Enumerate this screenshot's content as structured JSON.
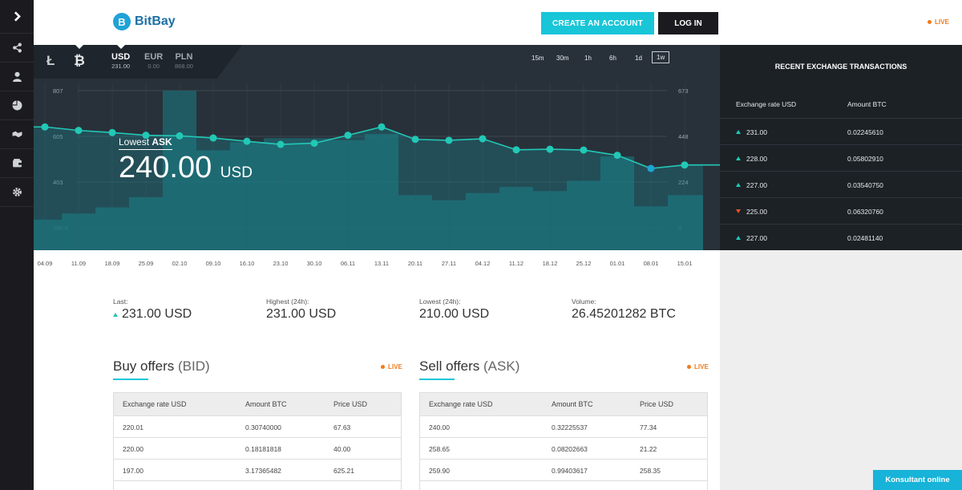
{
  "header": {
    "logo_text": "BitBay",
    "logo_badge": "B",
    "create_account": "CREATE AN ACCOUNT",
    "login": "LOG IN",
    "live": "LIVE"
  },
  "coins": {
    "litecoin": "Ł",
    "bitcoin": "₿"
  },
  "currencies": [
    {
      "name": "USD",
      "value": "231.00",
      "active": true
    },
    {
      "name": "EUR",
      "value": "0.00",
      "active": false
    },
    {
      "name": "PLN",
      "value": "868.00",
      "active": false
    }
  ],
  "timeframes": [
    {
      "label": "15m",
      "active": false
    },
    {
      "label": "30m",
      "active": false
    },
    {
      "label": "1h",
      "active": false
    },
    {
      "label": "6h",
      "active": false
    },
    {
      "label": "1d",
      "active": false
    },
    {
      "label": "1w",
      "active": true
    }
  ],
  "lowest_ask": {
    "label_prefix": "Lowest",
    "label_bold": "ASK",
    "value": "240.00",
    "unit": "USD"
  },
  "chart_data": {
    "type": "line",
    "x": [
      "04.09",
      "11.09",
      "18.09",
      "25.09",
      "02.10",
      "09.10",
      "16.10",
      "23.10",
      "30.10",
      "06.11",
      "13.11",
      "20.11",
      "27.11",
      "04.12",
      "11.12",
      "18.12",
      "25.12",
      "01.01",
      "08.01",
      "15.01"
    ],
    "left_ticks": [
      "807",
      "605",
      "403",
      "100.5"
    ],
    "right_ticks": [
      "673",
      "448",
      "224",
      "0"
    ],
    "ylim_left": [
      100.5,
      807
    ],
    "ylim_right": [
      0,
      673
    ],
    "series": [
      {
        "values": [
          620,
          602,
          591,
          577,
          574,
          563,
          546,
          530,
          536,
          577,
          620,
          556,
          551,
          559,
          502,
          505,
          501,
          474,
          406,
          424
        ]
      },
      {
        "values": [
          40,
          70,
          100,
          150,
          673,
          380,
          420,
          440,
          440,
          430,
          460,
          160,
          135,
          170,
          200,
          180,
          230,
          350,
          105,
          160
        ]
      }
    ]
  },
  "recent": {
    "title": "RECENT EXCHANGE TRANSACTIONS",
    "col_rate": "Exchange rate USD",
    "col_amount": "Amount BTC",
    "rows": [
      {
        "dir": "up",
        "rate": "231.00",
        "amount": "0.02245610"
      },
      {
        "dir": "up",
        "rate": "228.00",
        "amount": "0.05802910"
      },
      {
        "dir": "up",
        "rate": "227.00",
        "amount": "0.03540750"
      },
      {
        "dir": "down",
        "rate": "225.00",
        "amount": "0.06320760"
      },
      {
        "dir": "up",
        "rate": "227.00",
        "amount": "0.02481140"
      }
    ]
  },
  "stats": [
    {
      "label": "Last:",
      "value": "231.00 USD",
      "arrow": true
    },
    {
      "label": "Highest (24h):",
      "value": "231.00 USD",
      "arrow": false
    },
    {
      "label": "Lowest (24h):",
      "value": "210.00 USD",
      "arrow": false
    },
    {
      "label": "Volume:",
      "value": "26.45201282 BTC",
      "arrow": false
    }
  ],
  "buy": {
    "title": "Buy offers",
    "sub": "(BID)",
    "live": "LIVE",
    "cols": [
      "Exchange rate USD",
      "Amount BTC",
      "Price USD"
    ],
    "rows": [
      [
        "220.01",
        "0.30740000",
        "67.63"
      ],
      [
        "220.00",
        "0.18181818",
        "40.00"
      ],
      [
        "197.00",
        "3.17365482",
        "625.21"
      ]
    ]
  },
  "sell": {
    "title": "Sell offers",
    "sub": "(ASK)",
    "live": "LIVE",
    "cols": [
      "Exchange rate USD",
      "Amount BTC",
      "Price USD"
    ],
    "rows": [
      [
        "240.00",
        "0.32225537",
        "77.34"
      ],
      [
        "258.65",
        "0.08202663",
        "21.22"
      ],
      [
        "259.90",
        "0.99403617",
        "258.35"
      ]
    ]
  },
  "konsultant": "Konsultant online",
  "sidebar_icons": [
    "expand-icon",
    "share-icon",
    "user-icon",
    "pie-icon",
    "handshake-icon",
    "wallet-icon",
    "gear-icon"
  ]
}
